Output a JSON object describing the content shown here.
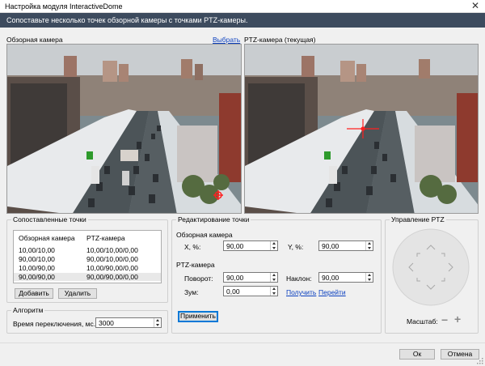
{
  "window": {
    "title": "Настройка модуля InteractiveDome",
    "close_glyph": "✕"
  },
  "banner": {
    "text": "Сопоставьте несколько точек обзорной камеры с точками PTZ-камеры."
  },
  "overview": {
    "label": "Обзорная камера",
    "select_link": "Выбрать"
  },
  "ptz_view": {
    "label": "PTZ-камера (текущая)"
  },
  "matched": {
    "legend": "Сопоставленные точки",
    "columns": [
      "Обзорная камера",
      "PTZ-камера"
    ],
    "rows": [
      {
        "overview": "10,00/10,00",
        "ptz": "10,00/10,00/0,00",
        "selected": false
      },
      {
        "overview": "90,00/10,00",
        "ptz": "90,00/10,00/0,00",
        "selected": false
      },
      {
        "overview": "10,00/90,00",
        "ptz": "10,00/90,00/0,00",
        "selected": false
      },
      {
        "overview": "90,00/90,00",
        "ptz": "90,00/90,00/0,00",
        "selected": true
      }
    ],
    "add_button": "Добавить",
    "delete_button": "Удалить"
  },
  "algorithm": {
    "legend": "Алгоритм",
    "switch_time_label": "Время переключения, мс.:",
    "switch_time_value": "3000"
  },
  "edit": {
    "legend": "Редактирование точки",
    "overview_section": "Обзорная камера",
    "x_label": "X, %:",
    "x_value": "90,00",
    "y_label": "Y, %:",
    "y_value": "90,00",
    "ptz_section": "PTZ-камера",
    "pan_label": "Поворот:",
    "pan_value": "90,00",
    "tilt_label": "Наклон:",
    "tilt_value": "90,00",
    "zoom_label": "Зум:",
    "zoom_value": "0,00",
    "get_link": "Получить",
    "goto_link": "Перейти",
    "apply_button": "Применить"
  },
  "ptz_control": {
    "legend": "Управление PTZ",
    "scale_label": "Масштаб:",
    "zoom_out_glyph": "−",
    "zoom_in_glyph": "+"
  },
  "footer": {
    "ok_button": "Ок",
    "cancel_button": "Отмена"
  },
  "colors": {
    "banner": "#3d4b5e",
    "link": "#0a3fbf",
    "marker": "#ff2020"
  }
}
